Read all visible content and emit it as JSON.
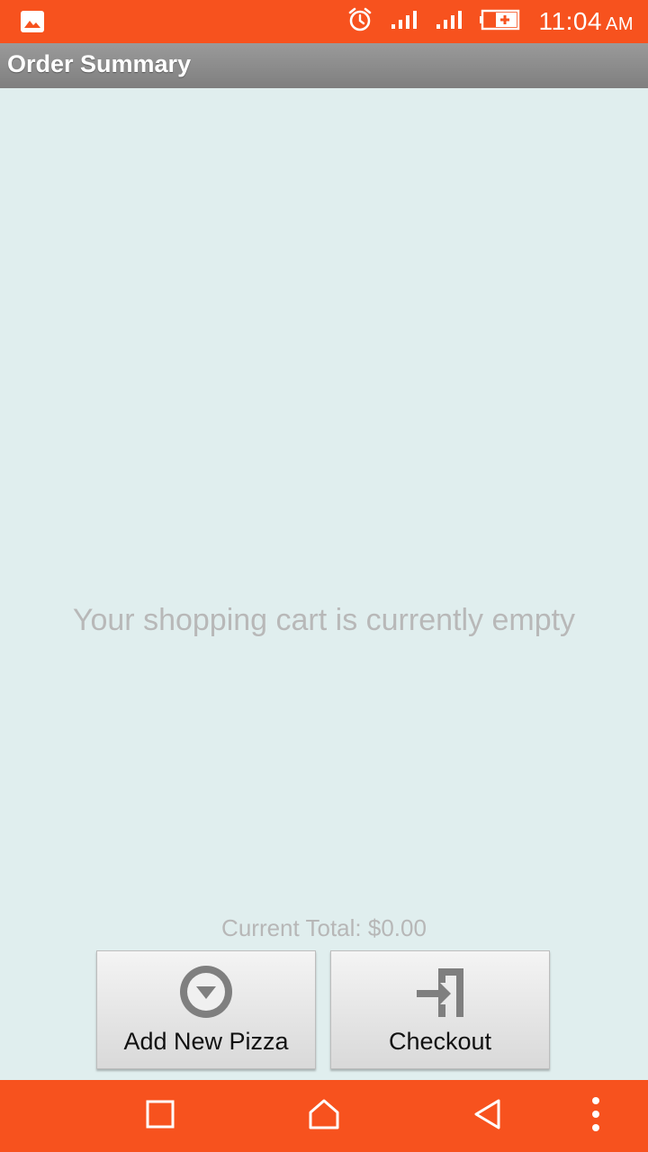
{
  "status_bar": {
    "time": "11:04",
    "ampm": "AM",
    "icons": [
      "image-icon",
      "alarm-icon",
      "signal-icon",
      "signal-icon",
      "battery-icon"
    ]
  },
  "title_bar": {
    "title": "Order Summary"
  },
  "main": {
    "empty_message": "Your shopping cart is currently empty",
    "total_label": "Current Total: $0.00"
  },
  "buttons": {
    "add_label": "Add New Pizza",
    "checkout_label": "Checkout"
  },
  "nav_bar": {
    "items": [
      "recents-icon",
      "home-icon",
      "back-icon",
      "menu-icon"
    ]
  },
  "colors": {
    "accent": "#f7521e",
    "background": "#e0eeee",
    "title_bar": "#8a8a8a"
  }
}
